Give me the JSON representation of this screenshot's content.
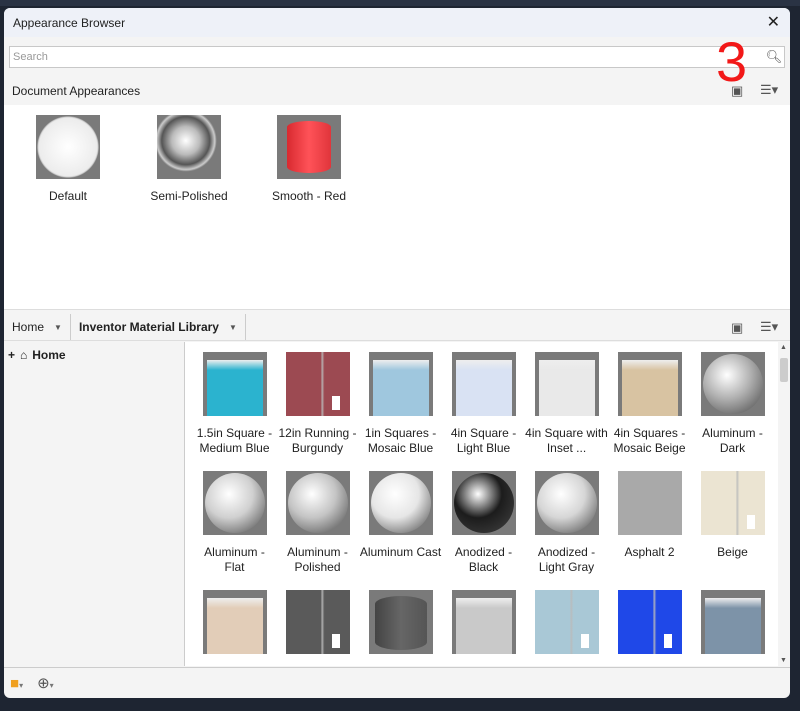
{
  "window": {
    "title": "Appearance Browser",
    "close_icon": "close-icon"
  },
  "search": {
    "placeholder": "Search",
    "value": ""
  },
  "annotation": "3",
  "document_section": {
    "title": "Document Appearances",
    "items": [
      {
        "label": "Default"
      },
      {
        "label": "Semi-Polished"
      },
      {
        "label": "Smooth - Red"
      }
    ]
  },
  "library_bar": {
    "location": "Home",
    "library": "Inventor Material Library"
  },
  "tree": {
    "items": [
      {
        "label": "Home"
      }
    ]
  },
  "library_items": [
    {
      "label": "1.5in Square - Medium Blue",
      "color": "#2bb3cf",
      "shape": "cube"
    },
    {
      "label": "12in Running - Burgundy",
      "color": "#9c4a52",
      "shape": "wall"
    },
    {
      "label": "1in Squares - Mosaic Blue",
      "color": "#9fc7de",
      "shape": "cube"
    },
    {
      "label": "4in Square - Light Blue",
      "color": "#d9e2f3",
      "shape": "cube"
    },
    {
      "label": "4in Square with Inset ...",
      "color": "#e9e9e9",
      "shape": "cube"
    },
    {
      "label": "4in Squares - Mosaic Beige",
      "color": "#d8c3a2",
      "shape": "cube"
    },
    {
      "label": "Aluminum - Dark",
      "color": "#b0b0b0",
      "shape": "sphere"
    },
    {
      "label": "Aluminum - Flat",
      "color": "#d0d0d0",
      "shape": "sphere"
    },
    {
      "label": "Aluminum - Polished",
      "color": "#c4c4c4",
      "shape": "sphere"
    },
    {
      "label": "Aluminum Cast",
      "color": "#e6e6e6",
      "shape": "sphere"
    },
    {
      "label": "Anodized - Black",
      "color": "#1c1c1c",
      "shape": "sphere"
    },
    {
      "label": "Anodized - Light Gray",
      "color": "#d6d6d6",
      "shape": "sphere"
    },
    {
      "label": "Asphalt 2",
      "color": "#a9a9a9",
      "shape": "flat"
    },
    {
      "label": "Beige",
      "color": "#ebe4d2",
      "shape": "wall"
    },
    {
      "label": "",
      "color": "#e2cdb8",
      "shape": "cube"
    },
    {
      "label": "",
      "color": "#5a5a5a",
      "shape": "wall"
    },
    {
      "label": "",
      "color": "#666666",
      "shape": "cyl"
    },
    {
      "label": "",
      "color": "#c9c9c9",
      "shape": "cube"
    },
    {
      "label": "",
      "color": "#a9c8d6",
      "shape": "wall"
    },
    {
      "label": "",
      "color": "#1f48e8",
      "shape": "wall"
    },
    {
      "label": "",
      "color": "#7d93a8",
      "shape": "cube"
    }
  ]
}
